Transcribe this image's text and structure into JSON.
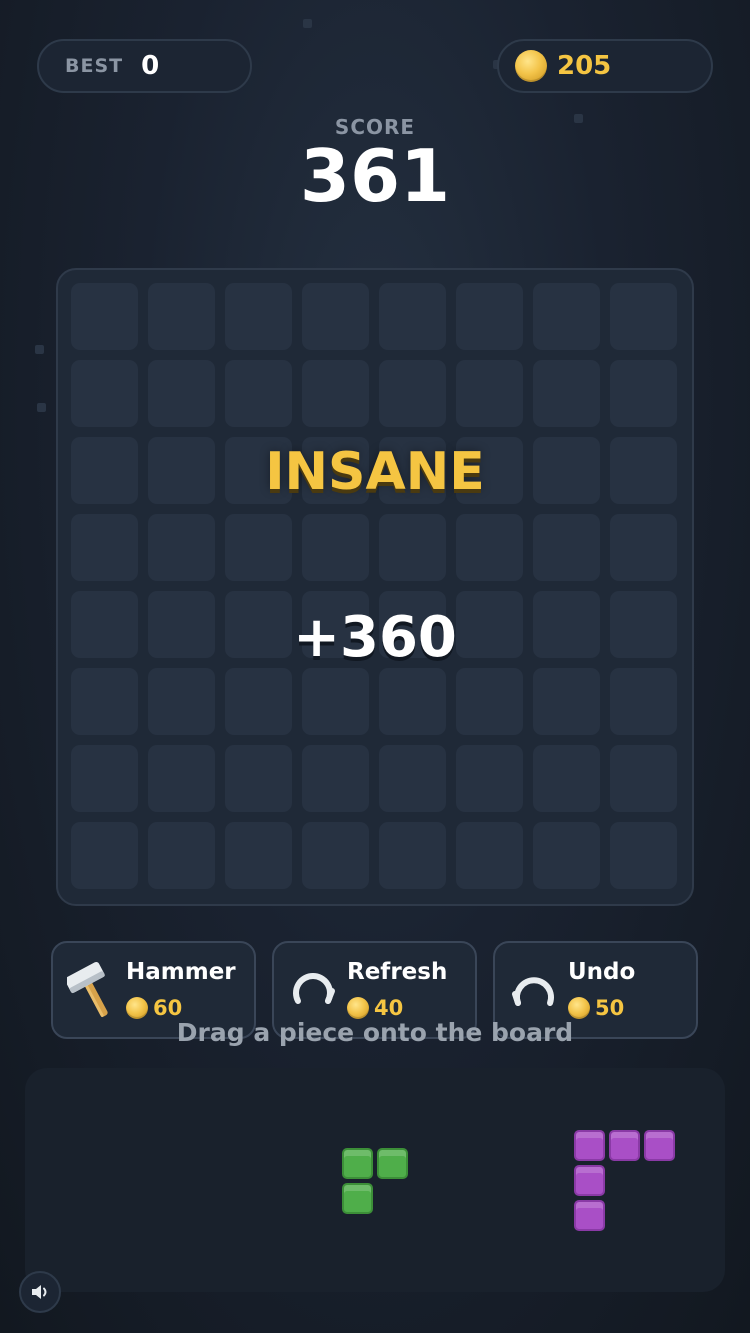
{
  "header": {
    "best_label": "BEST",
    "best_value": "0",
    "coins": "205",
    "coin_icon": "coin-icon"
  },
  "score": {
    "label": "SCORE",
    "value": "361"
  },
  "board": {
    "rows": 8,
    "cols": 8,
    "combo_text": "INSANE",
    "points_text": "+360"
  },
  "powerups": [
    {
      "name": "Hammer",
      "cost": "60",
      "icon": "hammer-icon"
    },
    {
      "name": "Refresh",
      "cost": "40",
      "icon": "refresh-icon"
    },
    {
      "name": "Undo",
      "cost": "50",
      "icon": "undo-icon"
    }
  ],
  "hint": "Drag a piece onto the board",
  "tray": {
    "pieces": [
      {
        "name": "green-piece",
        "color": "#4fae4a"
      },
      {
        "name": "purple-piece",
        "color": "#a94fc6"
      }
    ]
  },
  "colors": {
    "accent": "#f5c542",
    "background": "#1a2230"
  }
}
